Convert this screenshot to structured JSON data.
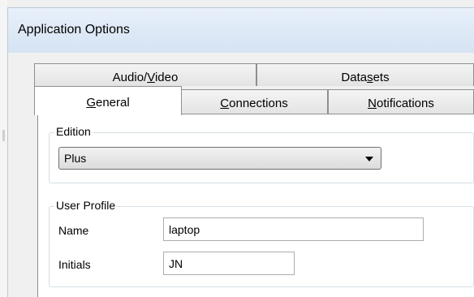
{
  "window": {
    "title": "Application Options"
  },
  "tabs": {
    "row1": [
      {
        "label_pre": "Audio/",
        "label_u": "V",
        "label_post": "ideo"
      },
      {
        "label_pre": "Data",
        "label_u": "s",
        "label_post": "ets"
      }
    ],
    "row2": [
      {
        "label_pre": "",
        "label_u": "G",
        "label_post": "eneral",
        "selected": true
      },
      {
        "label_pre": "",
        "label_u": "C",
        "label_post": "onnections"
      },
      {
        "label_pre": "",
        "label_u": "N",
        "label_post": "otifications"
      }
    ]
  },
  "edition": {
    "legend": "Edition",
    "selected": "Plus"
  },
  "user_profile": {
    "legend": "User Profile",
    "name_label": "Name",
    "name_value": "laptop",
    "initials_label": "Initials",
    "initials_value": "JN"
  },
  "colors": {
    "title_bg_top": "#e8f0fa",
    "title_bg_bottom": "#d5e3f3",
    "panel_bg": "#ffffff"
  }
}
